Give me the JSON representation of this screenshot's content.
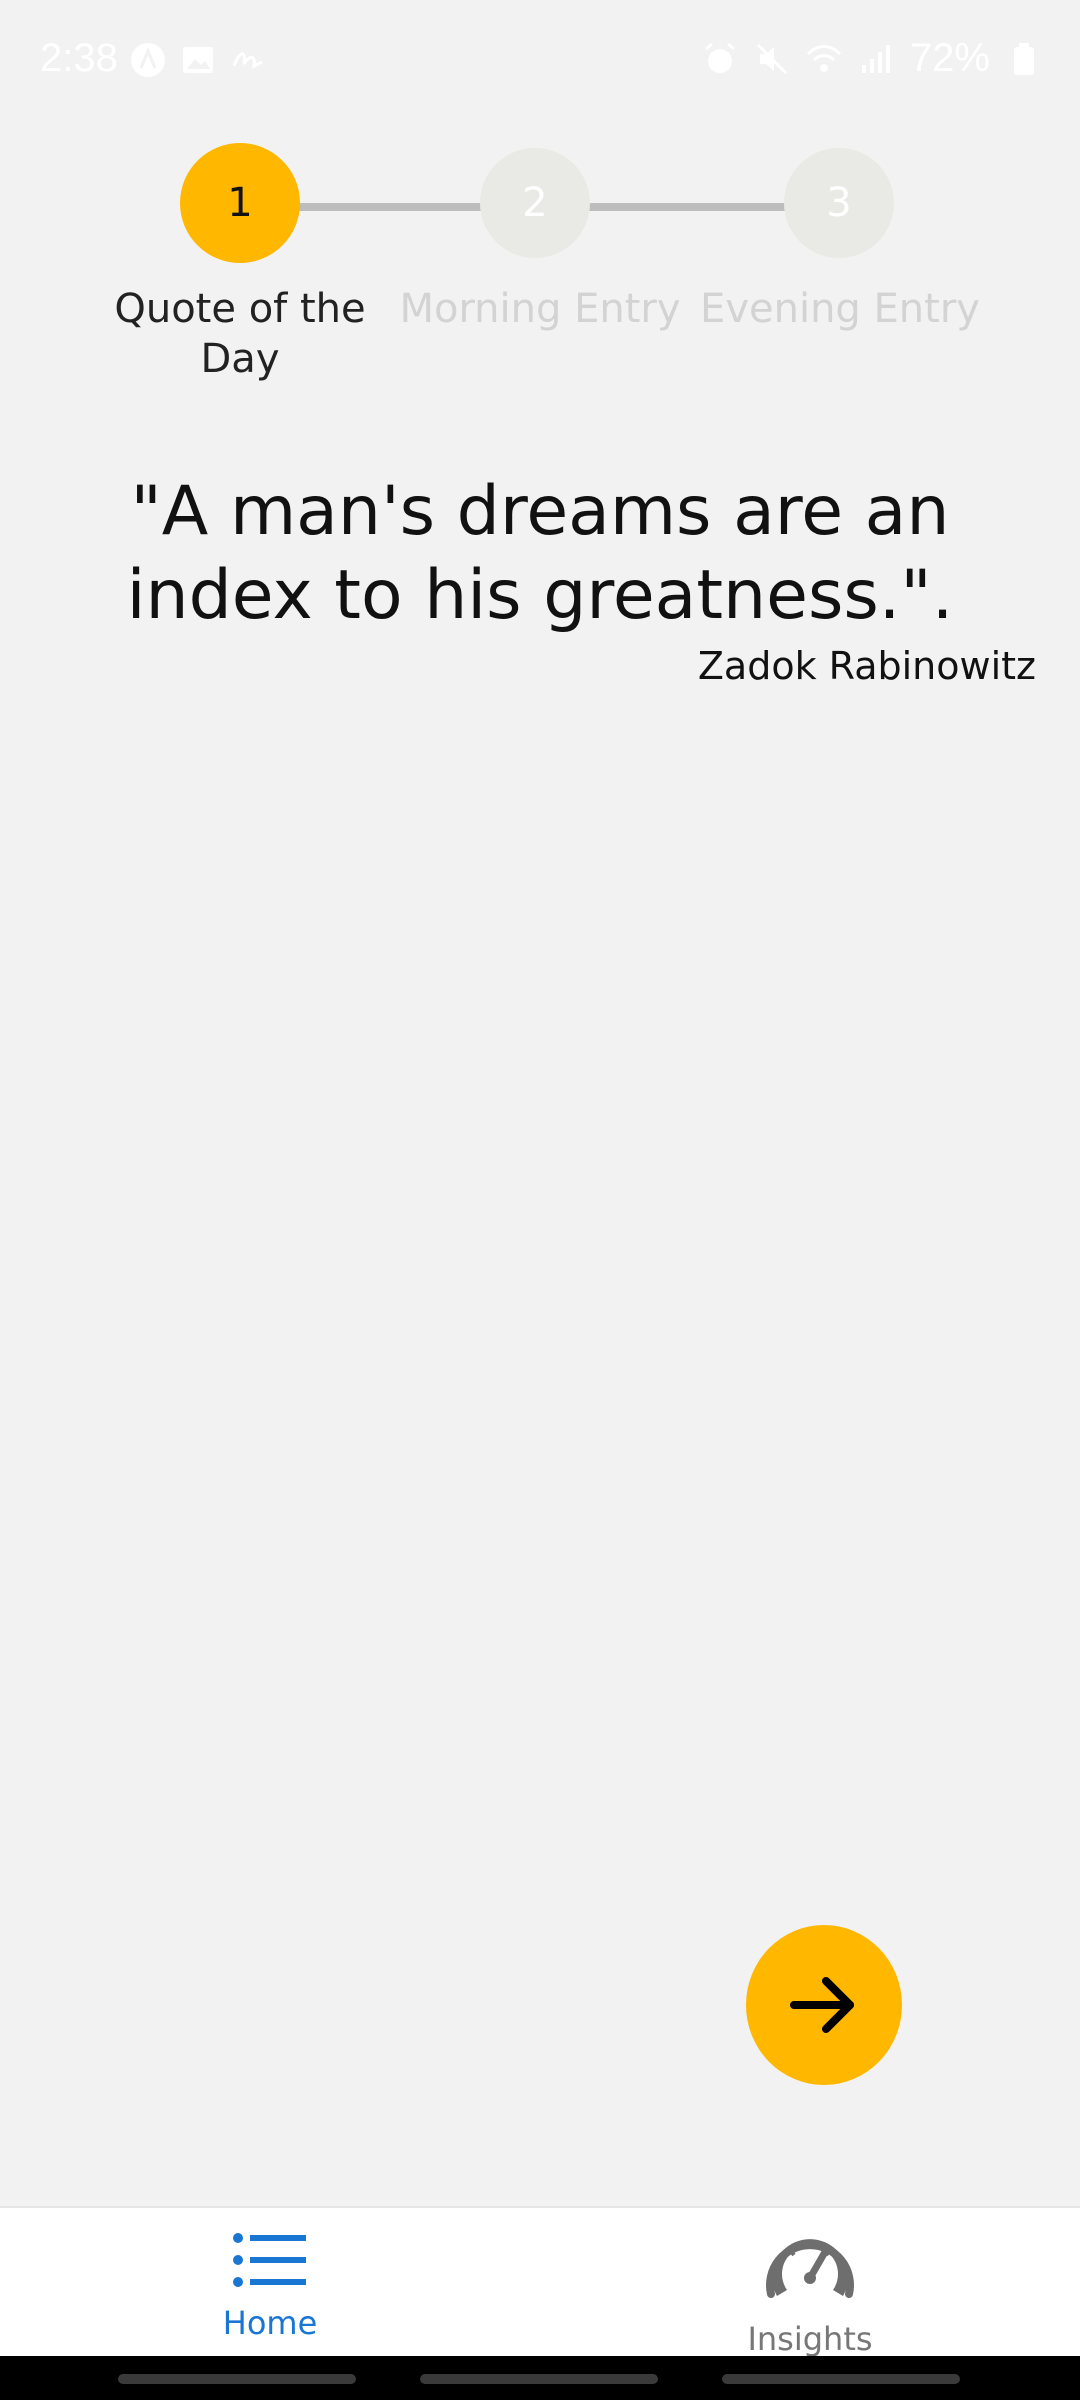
{
  "status_bar": {
    "time": "2:38",
    "battery_text": "72%",
    "left_icons": [
      "aa-circle-icon",
      "image-icon",
      "signature-icon"
    ],
    "right_icons": [
      "alarm-icon",
      "mute-icon",
      "wifi-icon",
      "signal-icon",
      "battery-icon"
    ]
  },
  "stepper": {
    "steps": [
      {
        "number": "1",
        "label": "Quote of the Day",
        "active": true
      },
      {
        "number": "2",
        "label": "Morning Entry",
        "active": false
      },
      {
        "number": "3",
        "label": "Evening Entry",
        "active": false
      }
    ]
  },
  "quote": {
    "text": "\"A man's dreams are an index to his greatness.\".",
    "author": "Zadok Rabinowitz"
  },
  "fab": {
    "icon": "arrow-right-icon"
  },
  "bottom_nav": {
    "items": [
      {
        "label": "Home",
        "icon": "list-icon",
        "selected": true
      },
      {
        "label": "Insights",
        "icon": "speedometer-icon",
        "selected": false
      }
    ]
  },
  "colors": {
    "accent": "#ffb700",
    "background": "#f2f2f2",
    "nav_selected": "#1976d2",
    "nav_unselected": "#777777",
    "step_inactive": "#e9e9e5"
  }
}
